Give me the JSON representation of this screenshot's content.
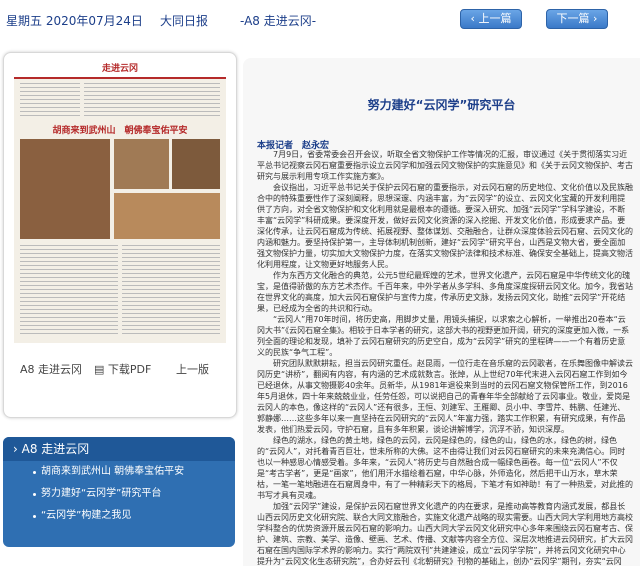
{
  "topbar": {
    "date": "星期五 2020年07月24日",
    "paper": "大同日报",
    "page": "-A8 走进云冈-",
    "prev": "上一篇",
    "next": "下一篇"
  },
  "paper_preview": {
    "masthead": "走进云冈",
    "headline": "胡商来到武州山　朝佛奉宝佑平安",
    "page_label": "A8 走进云冈",
    "download": "下载PDF",
    "up": "上一版"
  },
  "sidebar": {
    "section": "A8 走进云冈",
    "items": [
      "胡商来到武州山 朝佛奉宝佑平安",
      "努力建好“云冈学”研究平台",
      "“云冈学”构建之我见"
    ]
  },
  "article": {
    "title": "努力建好“云冈学”研究平台",
    "byline": "本报记者　赵永宏",
    "paragraphs": [
      "7月9日，省委常委会召开会议，听取全省文物保护工作等情况的汇报，审议通过《关于贯彻落实习近平总书记视察云冈石窟重要指示设立云冈学和加强云冈文物保护的实施意见》和《关于云冈文物保护、考古研究与展示利用专项工作实施方案》。",
      "会议指出，习近平总书记关于保护云冈石窟的重要指示，对云冈石窟的历史地位、文化价值以及民族融合中的特殊重要性作了深刻阐释，思想深邃、内涵丰富，为“云冈学”的设立、云冈文化宝藏的开发利用提供了方向，对全省文物保护和文化利用就是最根本的遵循。要深入研究、加强“云冈学”学科学建设，不断丰富“云冈学”科研成果。要深度开发，做好云冈文化资源的深入挖掘、开发文化价值，形成要求产品。要深化传承，让云冈石窟成为传统、拓展视野、整体谋划、交融融合，让群众深度体验云冈石窟、云冈文化的内涵和魅力。要坚持保护第一，主导体制机制创新，建好“云冈学”研究平台，山西是文物大省，要全面加强文物保护力量，切实加大文物保护力度，在落实文物保护法律和技术标准、确保安全基础上，提高文物活化利用程度，让文物更好地服务人民。",
      "作为东西方文化融合的典范，公元5世纪最辉煌的艺术，世界文化遗产，云冈石窟是中华传统文化的瑰宝，是值得骄傲的东方艺术杰作。千百年来，中外学者从多学科、多角度深度探研云冈文化。加今，我省站在世界文化的高度，加大云冈石窟保护与宣传力度，传承历史文脉，发扬云冈文化，助推“云冈学”开花结果，已经成为全省的共识和行动。",
      "“云冈人”用70年时间，将历史高，用脚步丈量，用镜头捕捉，以求索之心解析，一举推出20卷本“云冈大书”《云冈石窟全集》。相较于日本学者的研究，这部大书的视野更加开阔，研究的深度更加入微，一系列全面的理论和发现，填补了云冈石窟研究的历史空白，成为“云冈学”研究的里程碑——一个有着历史意义的民族“争气工程”。",
      "研究团队默默耕耘，担当云冈研究重任。赵昆雨，一位行走在音乐窟的云冈歌者，在乐舞图像中解读云冈历史“讲桥”，翻阅有内容，有内涵的艺术成就数言。张焯，从上世纪70年代末进入云冈石窟工作到如今已经退休，从事文物摄影40余年。员新华，从1981年退役来到当时的云冈石窟文物保管所工作，到2016年5月退休，四十年来兢兢业业，任劳任怨，可以说把自己的青春年华全部献给了云冈事业。敬业，爱岗是云冈人的本色，像这样的“云冈人”还有很多，王恒、刘建军、王雁卿、员小中、李雪芹、韩鹏、任建光、郭静娜……这些多年以来一直坚持在云冈研究的“云冈人”年富力强，踏实工作积累，有研究成果，有作品发表，他们热爱云冈，守护石窟，且有多年积累，谈论讲解博学，沉浮不骄，知识深厚。",
      "绿色的湖水，绿色的黄土地，绿色的云冈，云冈是绿色的，绿色的山，绿色的水，绿色的树，绿色的“云冈人”，对托着青百巨壮，世未所称的大佛。这不由得让我们对云冈石窟研究的未来充满信心。同时也以一种感恩心情感受着。多年来，“云冈人”将历史与自然融合成一幅绿色画卷。每一位“云冈人”不仅是“考古学者”，更是“画家”，他们用汗水描绘着石窟，中华心脉，外师造化，然后把干山万水，草木荣枯，一笔一笔地融进在石窟周身中，有了一种精彩天下的格局，下笔才有如神助！有了一种热爱，对此推的书写才具有灵魂。",
      "加强“云冈学”建设，是保护云冈石窟世界文化遗产的内在要求，是推动高等教育内涵式发展，都县长山西云冈历史文化研究院、联合大同文旅融合，实施文化遗产战略的现实需要。山西大同大学利用地方高校学科整合的优势资源开展云冈石窟的影响力。山西大同大学云冈文化研究中心多年来围绕云冈石窟考古、保护、建筑、宗教、美学、造像、壁画、艺术、传播、文献等内容全方位、深层次地推进云冈研究，扩大云冈石窟在国内国际学术界的影响力。实行“两院双刊”共建建设，成立“云冈学学院”，并将云冈文化研究中心提升为“云冈文化生态研究院”，合办好云刊《北朝研究》刊物的基础上，创办“云冈学”期刊，夯实“云冈学”人才培养与学术研究平台。"
    ]
  },
  "colors": {
    "accent": "#1d3f8a",
    "sidebar": "#2f6fb2",
    "button": "#3a79c8"
  }
}
